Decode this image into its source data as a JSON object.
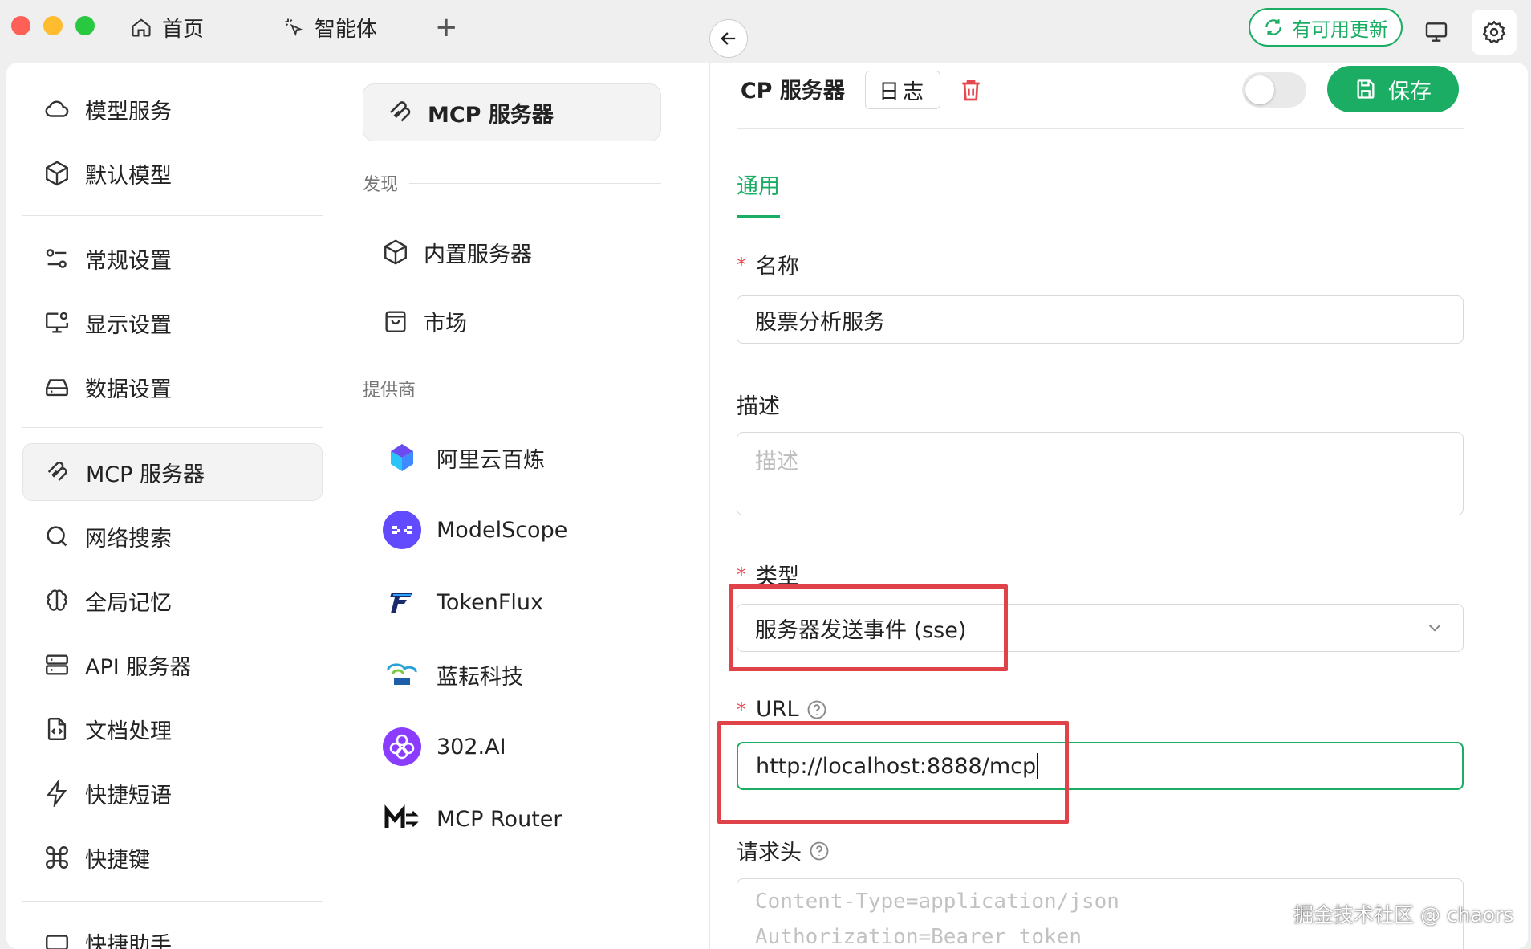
{
  "titlebar": {
    "tabs": [
      {
        "label": "首页",
        "icon": "home-icon"
      },
      {
        "label": "智能体",
        "icon": "sparkle-cursor-icon"
      }
    ],
    "add_tab": "+",
    "update_label": "有可用更新"
  },
  "sidebar": {
    "items": [
      {
        "label": "模型服务",
        "icon": "cloud-icon"
      },
      {
        "label": "默认模型",
        "icon": "cube-icon"
      },
      {
        "label": "常规设置",
        "icon": "sliders-icon"
      },
      {
        "label": "显示设置",
        "icon": "monitor-settings-icon"
      },
      {
        "label": "数据设置",
        "icon": "hard-drive-icon"
      },
      {
        "label": "MCP 服务器",
        "icon": "mcp-icon"
      },
      {
        "label": "网络搜索",
        "icon": "search-icon"
      },
      {
        "label": "全局记忆",
        "icon": "brain-icon"
      },
      {
        "label": "API 服务器",
        "icon": "server-icon"
      },
      {
        "label": "文档处理",
        "icon": "file-code-icon"
      },
      {
        "label": "快捷短语",
        "icon": "zap-icon"
      },
      {
        "label": "快捷键",
        "icon": "command-icon"
      },
      {
        "label": "快捷助手",
        "icon": "assistant-icon"
      }
    ],
    "active": "MCP 服务器"
  },
  "mcp_list": {
    "header": "MCP 服务器",
    "discover_label": "发现",
    "discover_items": [
      {
        "label": "内置服务器",
        "icon": "cube-icon"
      },
      {
        "label": "市场",
        "icon": "shopping-bag-icon"
      }
    ],
    "providers_label": "提供商",
    "providers": [
      {
        "label": "阿里云百炼",
        "color": "#6c4cf0"
      },
      {
        "label": "ModelScope",
        "color": "#624aff"
      },
      {
        "label": "TokenFlux",
        "color": "#1a2b6b"
      },
      {
        "label": "蓝耘科技",
        "color": "#2aa2d8"
      },
      {
        "label": "302.AI",
        "color": "#8b3dff"
      },
      {
        "label": "MCP Router",
        "color": "#111111"
      }
    ]
  },
  "detail": {
    "title": "MCP 服务器",
    "log_label": "日志",
    "save_label": "保存",
    "enabled": false,
    "tab_general": "通用",
    "name_label": "名称",
    "name_value": "股票分析服务",
    "desc_label": "描述",
    "desc_placeholder": "描述",
    "type_label": "类型",
    "type_value": "服务器发送事件 (sse)",
    "url_label": "URL",
    "url_value": "http://localhost:8888/mcp",
    "headers_label": "请求头",
    "headers_placeholder_1": "Content-Type=application/json",
    "headers_placeholder_2": "Authorization=Bearer token"
  },
  "watermark": "掘金技术社区 @ chaors",
  "colors": {
    "accent": "#1aad63",
    "highlight": "#e0424a",
    "required": "#e5484d"
  }
}
